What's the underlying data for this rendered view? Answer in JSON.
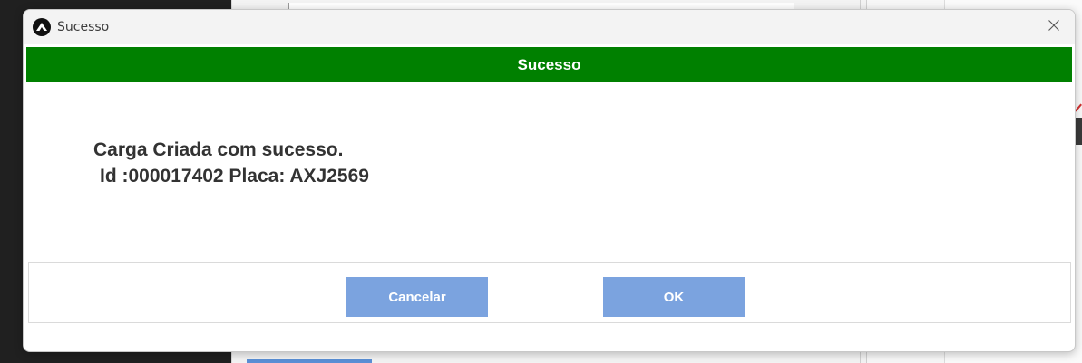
{
  "window": {
    "title": "Sucesso",
    "app_icon": "app-logo-icon",
    "close_icon": "close-icon"
  },
  "dialog": {
    "header_title": "Sucesso",
    "header_color": "#008000",
    "message_line1": "Carga Criada com sucesso.",
    "message_line2": "Id :000017402 Placa: AXJ2569"
  },
  "buttons": {
    "cancel_label": "Cancelar",
    "ok_label": "OK",
    "color": "#7ba3df"
  }
}
